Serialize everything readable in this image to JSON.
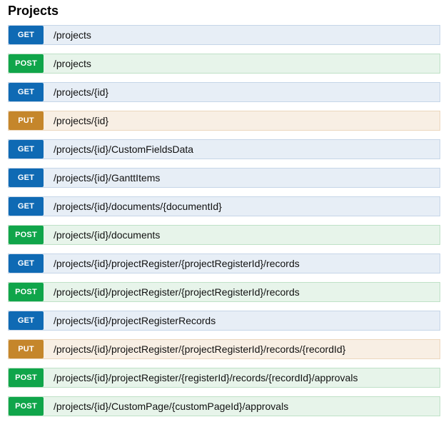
{
  "section": {
    "title": "Projects"
  },
  "operations": [
    {
      "method": "GET",
      "path": "/projects"
    },
    {
      "method": "POST",
      "path": "/projects"
    },
    {
      "method": "GET",
      "path": "/projects/{id}"
    },
    {
      "method": "PUT",
      "path": "/projects/{id}"
    },
    {
      "method": "GET",
      "path": "/projects/{id}/CustomFieldsData"
    },
    {
      "method": "GET",
      "path": "/projects/{id}/GanttItems"
    },
    {
      "method": "GET",
      "path": "/projects/{id}/documents/{documentId}"
    },
    {
      "method": "POST",
      "path": "/projects/{id}/documents"
    },
    {
      "method": "GET",
      "path": "/projects/{id}/projectRegister/{projectRegisterId}/records"
    },
    {
      "method": "POST",
      "path": "/projects/{id}/projectRegister/{projectRegisterId}/records"
    },
    {
      "method": "GET",
      "path": "/projects/{id}/projectRegisterRecords"
    },
    {
      "method": "PUT",
      "path": "/projects/{id}/projectRegister/{projectRegisterId}/records/{recordId}"
    },
    {
      "method": "POST",
      "path": "/projects/{id}/projectRegister/{registerId}/records/{recordId}/approvals"
    },
    {
      "method": "POST",
      "path": "/projects/{id}/CustomPage/{customPageId}/approvals"
    }
  ],
  "colors": {
    "get": "#0f6ab4",
    "post": "#10a54a",
    "put": "#c5862b"
  }
}
